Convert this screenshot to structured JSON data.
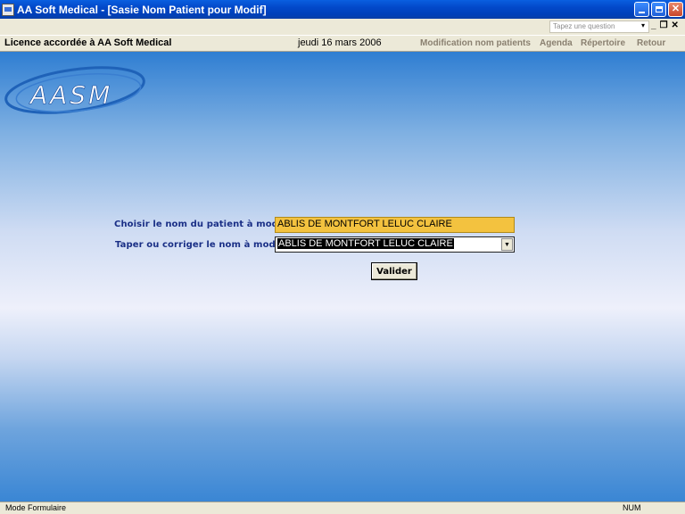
{
  "window": {
    "title": "AA Soft Medical - [Sasie Nom Patient pour Modif]"
  },
  "menurow": {
    "question_placeholder": "Tapez une question"
  },
  "infobar": {
    "license": "Licence accordée à  AA Soft Medical",
    "date": "jeudi 16 mars 2006",
    "nav": [
      "Modification nom patients",
      "Agenda",
      "Répertoire",
      "Retour"
    ]
  },
  "logo": {
    "text": "AASM"
  },
  "form": {
    "choose_label": "Choisir le nom du patient à modifier",
    "choose_value": "ABLIS DE MONTFORT LELUC CLAIRE",
    "edit_label": "Taper ou corriger le nom à modifier",
    "edit_value": "ABLIS DE MONTFORT LELUC CLAIRE",
    "submit_label": "Valider"
  },
  "statusbar": {
    "mode": "Mode Formulaire",
    "num": "NUM"
  },
  "colors": {
    "title_bar": "#0248c9",
    "label_text": "#1a2f86",
    "choose_field_bg": "#f3c23f",
    "nav_text": "#8a8070"
  },
  "icons": [
    "app-icon",
    "minimize-icon",
    "restore-icon",
    "close-icon",
    "dropdown-arrow-icon"
  ]
}
